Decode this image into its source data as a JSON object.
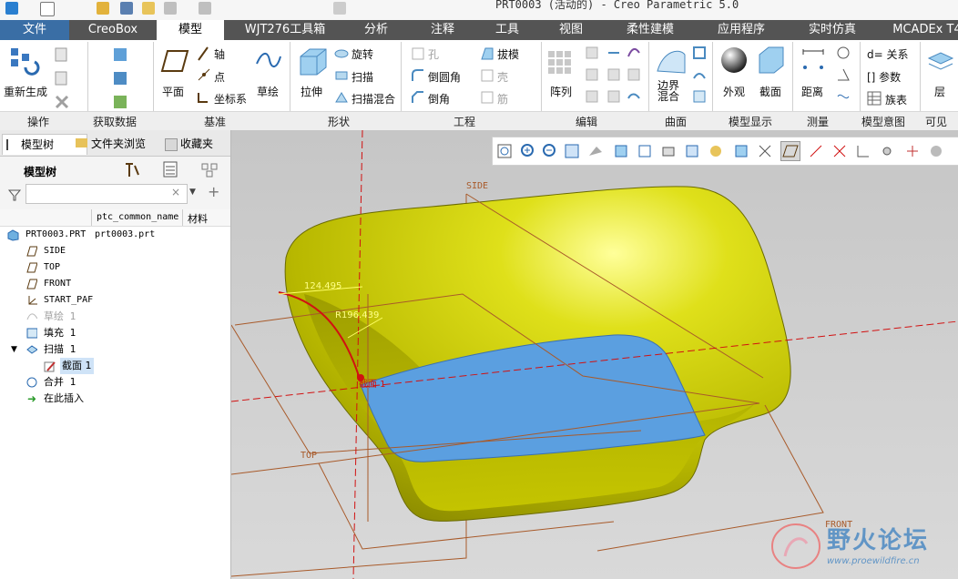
{
  "titlebar": {
    "title": "PRT0003 (活动的) - Creo Parametric 5.0"
  },
  "ribbon_tabs": [
    "文件",
    "CreoBox",
    "模型",
    "WJT276工具箱",
    "分析",
    "注释",
    "工具",
    "视图",
    "柔性建模",
    "应用程序",
    "实时仿真",
    "MCADEx T4"
  ],
  "active_tab": "模型",
  "ribbon": {
    "regen": "重新生成",
    "plane": "平面",
    "axis": "轴",
    "point": "点",
    "csys": "坐标系",
    "sketch": "草绘",
    "extrude": "拉伸",
    "revolve": "旋转",
    "sweep": "扫描",
    "swept_blend": "扫描混合",
    "hole": "孔",
    "round": "倒圆角",
    "chamfer": "倒角",
    "draft": "拔模",
    "shell": "壳",
    "rib": "筋",
    "pattern": "阵列",
    "boundary_blend": "边界\n混合",
    "appearance": "外观",
    "section": "截面",
    "distance": "距离",
    "relations": "d= 关系",
    "parameters": "[] 参数",
    "family_table": "族表",
    "layers": "层"
  },
  "group_labels": [
    "操作",
    "获取数据",
    "基准",
    "形状",
    "工程",
    "编辑",
    "曲面",
    "模型显示",
    "测量",
    "模型意图",
    "可见"
  ],
  "panel": {
    "tabs": [
      "模型树",
      "文件夹浏览",
      "收藏夹"
    ],
    "tree_title": "模型树",
    "filter_placeholder": "",
    "columns": [
      "ptc_common_name",
      "材料"
    ],
    "items": [
      {
        "label": "PRT0003.PRT",
        "value": "prt0003.prt",
        "icon": "part-icon"
      },
      {
        "label": "SIDE",
        "value": "",
        "icon": "datum-plane-icon"
      },
      {
        "label": "TOP",
        "value": "",
        "icon": "datum-plane-icon"
      },
      {
        "label": "FRONT",
        "value": "",
        "icon": "datum-plane-icon"
      },
      {
        "label": "START_PAF",
        "value": "",
        "icon": "csys-icon"
      },
      {
        "label": "草绘 1",
        "value": "",
        "icon": "sketch-icon"
      },
      {
        "label": "填充 1",
        "value": "",
        "icon": "fill-icon"
      },
      {
        "label": "扫描 1",
        "value": "",
        "icon": "sweep-icon"
      },
      {
        "label": "截面 1",
        "value": "",
        "icon": "section-sketch-icon"
      },
      {
        "label": "合并 1",
        "value": "",
        "icon": "merge-icon"
      },
      {
        "label": "在此插入",
        "value": "",
        "icon": "insert-here-icon"
      }
    ]
  },
  "viewport": {
    "datum_labels": {
      "side": "SIDE",
      "top": "TOP",
      "front": "FRONT"
    },
    "dimension_1": "124.495",
    "dimension_2": "R196.439",
    "section_label": "截面 1"
  },
  "watermark": {
    "text": "野火论坛",
    "url": "www.proewildfire.cn"
  },
  "colors": {
    "tab_bar": "#545454",
    "part_yellow": "#c8c800",
    "part_blue": "#5b9bd5",
    "datum_red": "#d11111"
  }
}
